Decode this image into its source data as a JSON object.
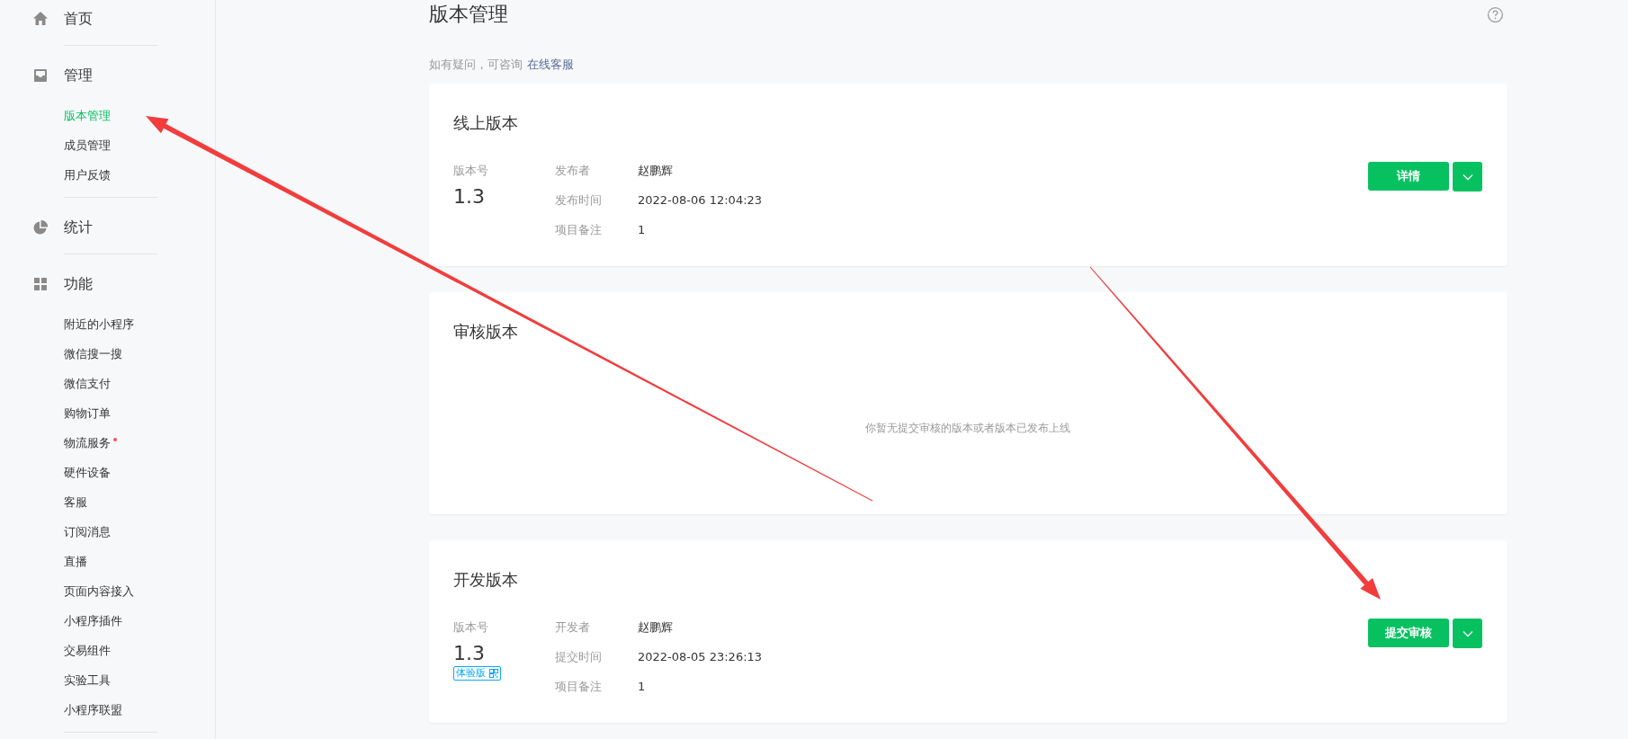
{
  "sidebar": {
    "groups": [
      {
        "label": "首页"
      },
      {
        "label": "管理",
        "items": [
          {
            "label": "版本管理",
            "selected": true,
            "dot": false
          },
          {
            "label": "成员管理",
            "selected": false,
            "dot": false
          },
          {
            "label": "用户反馈",
            "selected": false,
            "dot": false
          }
        ]
      },
      {
        "label": "统计"
      },
      {
        "label": "功能",
        "items": [
          {
            "label": "附近的小程序",
            "selected": false,
            "dot": false
          },
          {
            "label": "微信搜一搜",
            "selected": false,
            "dot": false
          },
          {
            "label": "微信支付",
            "selected": false,
            "dot": false
          },
          {
            "label": "购物订单",
            "selected": false,
            "dot": false
          },
          {
            "label": "物流服务",
            "selected": false,
            "dot": true
          },
          {
            "label": "硬件设备",
            "selected": false,
            "dot": false
          },
          {
            "label": "客服",
            "selected": false,
            "dot": false
          },
          {
            "label": "订阅消息",
            "selected": false,
            "dot": false
          },
          {
            "label": "直播",
            "selected": false,
            "dot": false
          },
          {
            "label": "页面内容接入",
            "selected": false,
            "dot": false
          },
          {
            "label": "小程序插件",
            "selected": false,
            "dot": false
          },
          {
            "label": "交易组件",
            "selected": false,
            "dot": false
          },
          {
            "label": "实验工具",
            "selected": false,
            "dot": false
          },
          {
            "label": "小程序联盟",
            "selected": false,
            "dot": false
          }
        ]
      }
    ]
  },
  "page": {
    "title": "版本管理",
    "hint": "如有疑问，可咨询",
    "hint_link": "在线客服"
  },
  "cards": [
    {
      "kind": "version",
      "title": "线上版本",
      "version_label": "版本号",
      "version": "1.3",
      "fields": [
        {
          "label": "发布者",
          "value": "赵鹏辉"
        },
        {
          "label": "发布时间",
          "value": "2022-08-06 12:04:23"
        },
        {
          "label": "项目备注",
          "value": "1"
        }
      ],
      "button": "详情"
    },
    {
      "kind": "empty",
      "title": "审核版本",
      "message": "你暂无提交审核的版本或者版本已发布上线"
    },
    {
      "kind": "version",
      "title": "开发版本",
      "version_label": "版本号",
      "version": "1.3",
      "badge": "体验版",
      "fields": [
        {
          "label": "开发者",
          "value": "赵鹏辉"
        },
        {
          "label": "提交时间",
          "value": "2022-08-05 23:26:13"
        },
        {
          "label": "项目备注",
          "value": "1"
        }
      ],
      "button": "提交审核"
    }
  ]
}
